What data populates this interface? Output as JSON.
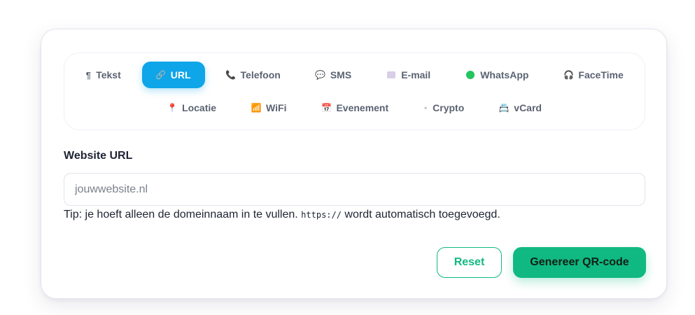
{
  "tabs_row1": [
    {
      "label": "Tekst",
      "icon": "pilcrow-icon",
      "glyph": "¶",
      "active": false
    },
    {
      "label": "URL",
      "icon": "link-icon",
      "glyph": "🔗",
      "active": true
    },
    {
      "label": "Telefoon",
      "icon": "phone-icon",
      "glyph": "📞",
      "active": false
    },
    {
      "label": "SMS",
      "icon": "speech-bubble-icon",
      "glyph": "💬",
      "active": false
    },
    {
      "label": "E-mail",
      "icon": "envelope-icon",
      "glyph": "",
      "active": false
    },
    {
      "label": "WhatsApp",
      "icon": "green-circle-icon",
      "glyph": "",
      "active": false
    },
    {
      "label": "FaceTime",
      "icon": "headphones-icon",
      "glyph": "🎧",
      "active": false
    }
  ],
  "tabs_row2": [
    {
      "label": "Locatie",
      "icon": "pin-icon",
      "glyph": "📍",
      "active": false
    },
    {
      "label": "WiFi",
      "icon": "signal-icon",
      "glyph": "📶",
      "active": false
    },
    {
      "label": "Evenement",
      "icon": "calendar-icon",
      "glyph": "📅",
      "active": false
    },
    {
      "label": "Crypto",
      "icon": "small-circle-icon",
      "glyph": "◦",
      "active": false
    },
    {
      "label": "vCard",
      "icon": "contact-card-icon",
      "glyph": "📇",
      "active": false
    }
  ],
  "form": {
    "label": "Website URL",
    "placeholder": "jouwwebsite.nl",
    "value": "",
    "tip_before": "Tip: je hoeft alleen de domeinnaam in te vullen. ",
    "tip_code": "https://",
    "tip_after": " wordt automatisch toegevoegd."
  },
  "buttons": {
    "reset": "Reset",
    "generate": "Genereer QR-code"
  },
  "colors": {
    "accent_blue": "#0ea5e9",
    "accent_green": "#10b981",
    "text_dark": "#1f2433",
    "tab_text": "#5b6372"
  }
}
